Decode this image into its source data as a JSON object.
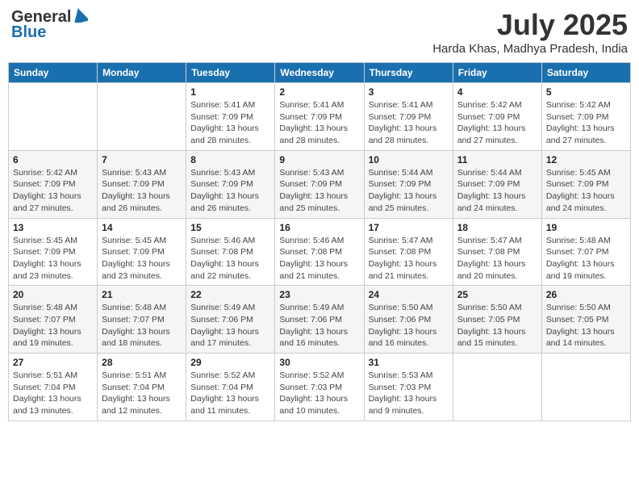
{
  "header": {
    "logo_general": "General",
    "logo_blue": "Blue",
    "month_title": "July 2025",
    "location": "Harda Khas, Madhya Pradesh, India"
  },
  "weekdays": [
    "Sunday",
    "Monday",
    "Tuesday",
    "Wednesday",
    "Thursday",
    "Friday",
    "Saturday"
  ],
  "weeks": [
    [
      {
        "day": "",
        "info": ""
      },
      {
        "day": "",
        "info": ""
      },
      {
        "day": "1",
        "info": "Sunrise: 5:41 AM\nSunset: 7:09 PM\nDaylight: 13 hours and 28 minutes."
      },
      {
        "day": "2",
        "info": "Sunrise: 5:41 AM\nSunset: 7:09 PM\nDaylight: 13 hours and 28 minutes."
      },
      {
        "day": "3",
        "info": "Sunrise: 5:41 AM\nSunset: 7:09 PM\nDaylight: 13 hours and 28 minutes."
      },
      {
        "day": "4",
        "info": "Sunrise: 5:42 AM\nSunset: 7:09 PM\nDaylight: 13 hours and 27 minutes."
      },
      {
        "day": "5",
        "info": "Sunrise: 5:42 AM\nSunset: 7:09 PM\nDaylight: 13 hours and 27 minutes."
      }
    ],
    [
      {
        "day": "6",
        "info": "Sunrise: 5:42 AM\nSunset: 7:09 PM\nDaylight: 13 hours and 27 minutes."
      },
      {
        "day": "7",
        "info": "Sunrise: 5:43 AM\nSunset: 7:09 PM\nDaylight: 13 hours and 26 minutes."
      },
      {
        "day": "8",
        "info": "Sunrise: 5:43 AM\nSunset: 7:09 PM\nDaylight: 13 hours and 26 minutes."
      },
      {
        "day": "9",
        "info": "Sunrise: 5:43 AM\nSunset: 7:09 PM\nDaylight: 13 hours and 25 minutes."
      },
      {
        "day": "10",
        "info": "Sunrise: 5:44 AM\nSunset: 7:09 PM\nDaylight: 13 hours and 25 minutes."
      },
      {
        "day": "11",
        "info": "Sunrise: 5:44 AM\nSunset: 7:09 PM\nDaylight: 13 hours and 24 minutes."
      },
      {
        "day": "12",
        "info": "Sunrise: 5:45 AM\nSunset: 7:09 PM\nDaylight: 13 hours and 24 minutes."
      }
    ],
    [
      {
        "day": "13",
        "info": "Sunrise: 5:45 AM\nSunset: 7:09 PM\nDaylight: 13 hours and 23 minutes."
      },
      {
        "day": "14",
        "info": "Sunrise: 5:45 AM\nSunset: 7:09 PM\nDaylight: 13 hours and 23 minutes."
      },
      {
        "day": "15",
        "info": "Sunrise: 5:46 AM\nSunset: 7:08 PM\nDaylight: 13 hours and 22 minutes."
      },
      {
        "day": "16",
        "info": "Sunrise: 5:46 AM\nSunset: 7:08 PM\nDaylight: 13 hours and 21 minutes."
      },
      {
        "day": "17",
        "info": "Sunrise: 5:47 AM\nSunset: 7:08 PM\nDaylight: 13 hours and 21 minutes."
      },
      {
        "day": "18",
        "info": "Sunrise: 5:47 AM\nSunset: 7:08 PM\nDaylight: 13 hours and 20 minutes."
      },
      {
        "day": "19",
        "info": "Sunrise: 5:48 AM\nSunset: 7:07 PM\nDaylight: 13 hours and 19 minutes."
      }
    ],
    [
      {
        "day": "20",
        "info": "Sunrise: 5:48 AM\nSunset: 7:07 PM\nDaylight: 13 hours and 19 minutes."
      },
      {
        "day": "21",
        "info": "Sunrise: 5:48 AM\nSunset: 7:07 PM\nDaylight: 13 hours and 18 minutes."
      },
      {
        "day": "22",
        "info": "Sunrise: 5:49 AM\nSunset: 7:06 PM\nDaylight: 13 hours and 17 minutes."
      },
      {
        "day": "23",
        "info": "Sunrise: 5:49 AM\nSunset: 7:06 PM\nDaylight: 13 hours and 16 minutes."
      },
      {
        "day": "24",
        "info": "Sunrise: 5:50 AM\nSunset: 7:06 PM\nDaylight: 13 hours and 16 minutes."
      },
      {
        "day": "25",
        "info": "Sunrise: 5:50 AM\nSunset: 7:05 PM\nDaylight: 13 hours and 15 minutes."
      },
      {
        "day": "26",
        "info": "Sunrise: 5:50 AM\nSunset: 7:05 PM\nDaylight: 13 hours and 14 minutes."
      }
    ],
    [
      {
        "day": "27",
        "info": "Sunrise: 5:51 AM\nSunset: 7:04 PM\nDaylight: 13 hours and 13 minutes."
      },
      {
        "day": "28",
        "info": "Sunrise: 5:51 AM\nSunset: 7:04 PM\nDaylight: 13 hours and 12 minutes."
      },
      {
        "day": "29",
        "info": "Sunrise: 5:52 AM\nSunset: 7:04 PM\nDaylight: 13 hours and 11 minutes."
      },
      {
        "day": "30",
        "info": "Sunrise: 5:52 AM\nSunset: 7:03 PM\nDaylight: 13 hours and 10 minutes."
      },
      {
        "day": "31",
        "info": "Sunrise: 5:53 AM\nSunset: 7:03 PM\nDaylight: 13 hours and 9 minutes."
      },
      {
        "day": "",
        "info": ""
      },
      {
        "day": "",
        "info": ""
      }
    ]
  ]
}
